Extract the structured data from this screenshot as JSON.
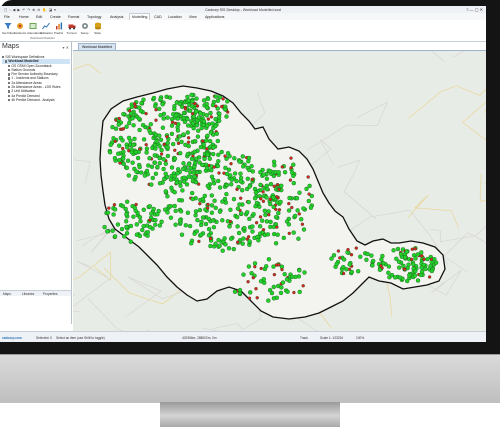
{
  "app": {
    "window_title": "Cadcorp SIS Desktop - Workload Modelled.swd",
    "qat_icons": "▢ ▫ ◀ ▶ ↶ ↷ ⊕ ⊖ ✋ ◪ ▾",
    "window_controls": "?  —  ▢  ✕"
  },
  "menu": {
    "tabs": [
      "File",
      "Home",
      "Edit",
      "Create",
      "Format",
      "Topology",
      "Analysis",
      "Modelling",
      "CAD",
      "Location",
      "View",
      "Applications"
    ],
    "active_tab": "Modelling"
  },
  "ribbon": {
    "buttons": [
      {
        "label": "Set Filters",
        "icon": "filter-icon"
      },
      {
        "label": "Incidents",
        "icon": "incidents-icon"
      },
      {
        "label": "Attendance",
        "icon": "attendance-icon"
      },
      {
        "label": "Utilisation",
        "icon": "utilisation-icon"
      },
      {
        "label": "Predict",
        "icon": "predict-icon"
      },
      {
        "label": "Turnout",
        "icon": "turnout-icon"
      },
      {
        "label": "Setup",
        "icon": "setup-icon"
      },
      {
        "label": "Stats",
        "icon": "stats-icon"
      }
    ],
    "group_label": "Workload Modeller"
  },
  "left_panel": {
    "title": "Maps",
    "header_buttons": "▾ ✕",
    "tree": [
      "SIS Workspace Definitions",
      "Workload Modelled",
      "OS OSMI Open Zoomstack",
      "Station Grounds",
      "Fire Service Authority Boundary",
      "1 - Incidents and Stations",
      "2a Attendance Areas",
      "2b Attendance Areas - LDS Rules",
      "3 Unit Utilisation",
      "4a Predict Demand",
      "4b Predict Demand - Analysis"
    ],
    "selected_index": 1,
    "bottom_tabs": [
      "Maps",
      "Libraries",
      "Properties"
    ]
  },
  "document": {
    "tab_label": "Workload Modelled"
  },
  "map": {
    "boundary_color": "#111111",
    "green_marker_color": "#22d12a",
    "red_marker_color": "#d92323",
    "land_color": "#f3f3f0",
    "outside_color": "#e8ece6"
  },
  "status": {
    "url": "cadcorp.com",
    "selected": "Selected: 0",
    "hint": "Select an item (use Shift to toggle)",
    "coords": "402966m, 288002m, 0m",
    "track": "Track",
    "scale": "Scale 1: 133234",
    "percent": "100%"
  }
}
